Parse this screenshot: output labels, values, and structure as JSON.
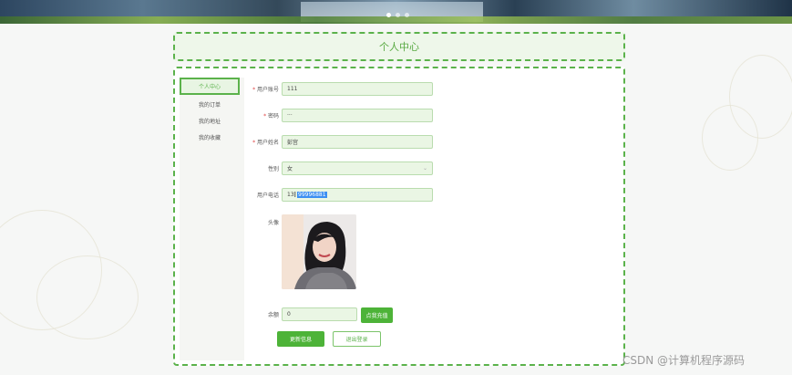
{
  "banner": {
    "slide_count": 3,
    "active_slide": 1
  },
  "page": {
    "title": "个人中心"
  },
  "sidebar": {
    "items": [
      {
        "label": "个人中心",
        "active": true
      },
      {
        "label": "我的订单",
        "active": false
      },
      {
        "label": "我的地址",
        "active": false
      },
      {
        "label": "我的收藏",
        "active": false
      }
    ]
  },
  "form": {
    "account": {
      "label": "用户账号",
      "required": true,
      "value": "111"
    },
    "password": {
      "label": "密码",
      "required": true,
      "value": "···"
    },
    "name": {
      "label": "用户姓名",
      "required": true,
      "value": "彭宫"
    },
    "gender": {
      "label": "性别",
      "value": "女"
    },
    "phone": {
      "label": "用户电话",
      "value_prefix": "13",
      "value_selected": "99996881"
    },
    "avatar": {
      "label": "头像"
    },
    "balance": {
      "label": "余额",
      "value": "0"
    }
  },
  "buttons": {
    "recharge": "点我充值",
    "update": "更新信息",
    "logout": "退出登录"
  },
  "watermark": "CSDN @计算机程序源码",
  "colors": {
    "accent": "#5bb24b",
    "selection": "#3c8ff2"
  }
}
